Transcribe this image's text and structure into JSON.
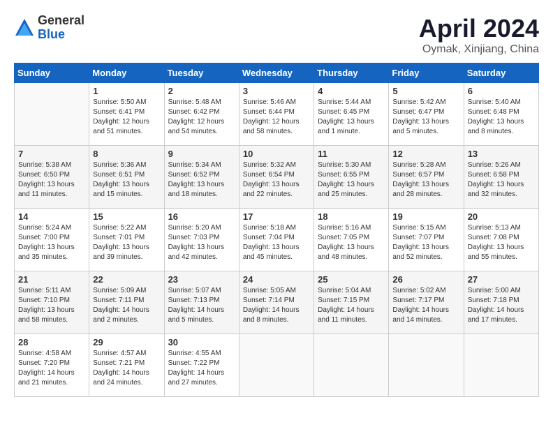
{
  "header": {
    "logo_general": "General",
    "logo_blue": "Blue",
    "title": "April 2024",
    "location": "Oymak, Xinjiang, China"
  },
  "calendar": {
    "headers": [
      "Sunday",
      "Monday",
      "Tuesday",
      "Wednesday",
      "Thursday",
      "Friday",
      "Saturday"
    ],
    "weeks": [
      [
        {
          "day": "",
          "info": ""
        },
        {
          "day": "1",
          "info": "Sunrise: 5:50 AM\nSunset: 6:41 PM\nDaylight: 12 hours\nand 51 minutes."
        },
        {
          "day": "2",
          "info": "Sunrise: 5:48 AM\nSunset: 6:42 PM\nDaylight: 12 hours\nand 54 minutes."
        },
        {
          "day": "3",
          "info": "Sunrise: 5:46 AM\nSunset: 6:44 PM\nDaylight: 12 hours\nand 58 minutes."
        },
        {
          "day": "4",
          "info": "Sunrise: 5:44 AM\nSunset: 6:45 PM\nDaylight: 13 hours\nand 1 minute."
        },
        {
          "day": "5",
          "info": "Sunrise: 5:42 AM\nSunset: 6:47 PM\nDaylight: 13 hours\nand 5 minutes."
        },
        {
          "day": "6",
          "info": "Sunrise: 5:40 AM\nSunset: 6:48 PM\nDaylight: 13 hours\nand 8 minutes."
        }
      ],
      [
        {
          "day": "7",
          "info": "Sunrise: 5:38 AM\nSunset: 6:50 PM\nDaylight: 13 hours\nand 11 minutes."
        },
        {
          "day": "8",
          "info": "Sunrise: 5:36 AM\nSunset: 6:51 PM\nDaylight: 13 hours\nand 15 minutes."
        },
        {
          "day": "9",
          "info": "Sunrise: 5:34 AM\nSunset: 6:52 PM\nDaylight: 13 hours\nand 18 minutes."
        },
        {
          "day": "10",
          "info": "Sunrise: 5:32 AM\nSunset: 6:54 PM\nDaylight: 13 hours\nand 22 minutes."
        },
        {
          "day": "11",
          "info": "Sunrise: 5:30 AM\nSunset: 6:55 PM\nDaylight: 13 hours\nand 25 minutes."
        },
        {
          "day": "12",
          "info": "Sunrise: 5:28 AM\nSunset: 6:57 PM\nDaylight: 13 hours\nand 28 minutes."
        },
        {
          "day": "13",
          "info": "Sunrise: 5:26 AM\nSunset: 6:58 PM\nDaylight: 13 hours\nand 32 minutes."
        }
      ],
      [
        {
          "day": "14",
          "info": "Sunrise: 5:24 AM\nSunset: 7:00 PM\nDaylight: 13 hours\nand 35 minutes."
        },
        {
          "day": "15",
          "info": "Sunrise: 5:22 AM\nSunset: 7:01 PM\nDaylight: 13 hours\nand 39 minutes."
        },
        {
          "day": "16",
          "info": "Sunrise: 5:20 AM\nSunset: 7:03 PM\nDaylight: 13 hours\nand 42 minutes."
        },
        {
          "day": "17",
          "info": "Sunrise: 5:18 AM\nSunset: 7:04 PM\nDaylight: 13 hours\nand 45 minutes."
        },
        {
          "day": "18",
          "info": "Sunrise: 5:16 AM\nSunset: 7:05 PM\nDaylight: 13 hours\nand 48 minutes."
        },
        {
          "day": "19",
          "info": "Sunrise: 5:15 AM\nSunset: 7:07 PM\nDaylight: 13 hours\nand 52 minutes."
        },
        {
          "day": "20",
          "info": "Sunrise: 5:13 AM\nSunset: 7:08 PM\nDaylight: 13 hours\nand 55 minutes."
        }
      ],
      [
        {
          "day": "21",
          "info": "Sunrise: 5:11 AM\nSunset: 7:10 PM\nDaylight: 13 hours\nand 58 minutes."
        },
        {
          "day": "22",
          "info": "Sunrise: 5:09 AM\nSunset: 7:11 PM\nDaylight: 14 hours\nand 2 minutes."
        },
        {
          "day": "23",
          "info": "Sunrise: 5:07 AM\nSunset: 7:13 PM\nDaylight: 14 hours\nand 5 minutes."
        },
        {
          "day": "24",
          "info": "Sunrise: 5:05 AM\nSunset: 7:14 PM\nDaylight: 14 hours\nand 8 minutes."
        },
        {
          "day": "25",
          "info": "Sunrise: 5:04 AM\nSunset: 7:15 PM\nDaylight: 14 hours\nand 11 minutes."
        },
        {
          "day": "26",
          "info": "Sunrise: 5:02 AM\nSunset: 7:17 PM\nDaylight: 14 hours\nand 14 minutes."
        },
        {
          "day": "27",
          "info": "Sunrise: 5:00 AM\nSunset: 7:18 PM\nDaylight: 14 hours\nand 17 minutes."
        }
      ],
      [
        {
          "day": "28",
          "info": "Sunrise: 4:58 AM\nSunset: 7:20 PM\nDaylight: 14 hours\nand 21 minutes."
        },
        {
          "day": "29",
          "info": "Sunrise: 4:57 AM\nSunset: 7:21 PM\nDaylight: 14 hours\nand 24 minutes."
        },
        {
          "day": "30",
          "info": "Sunrise: 4:55 AM\nSunset: 7:22 PM\nDaylight: 14 hours\nand 27 minutes."
        },
        {
          "day": "",
          "info": ""
        },
        {
          "day": "",
          "info": ""
        },
        {
          "day": "",
          "info": ""
        },
        {
          "day": "",
          "info": ""
        }
      ]
    ]
  }
}
